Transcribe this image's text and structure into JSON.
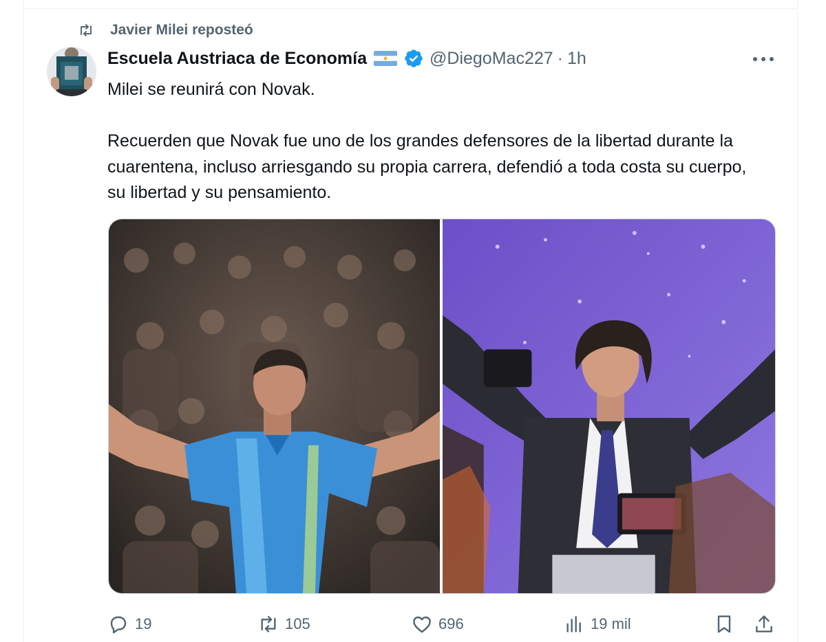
{
  "repost": {
    "icon": "retweet-icon",
    "text": "Javier Milei reposteó"
  },
  "author": {
    "display_name": "Escuela Austriaca de Economía",
    "flag": "argentina-flag-icon",
    "verified_icon": "verified-badge-icon",
    "handle": "@DiegoMac227",
    "separator": "·",
    "time": "1h"
  },
  "tweet": {
    "paragraphs": [
      "Milei se reunirá con Novak.",
      "Recuerden que Novak fue uno de los grandes defensores de la libertad durante la cuarentena, incluso arriesgando su propia carrera, defendió a toda costa su cuerpo, su libertad y su pensamiento."
    ]
  },
  "media": [
    {
      "kind": "photo",
      "subject": "tennis player celebrating with arms raised"
    },
    {
      "kind": "photo",
      "subject": "man in suit celebrating on stage with arms raised"
    }
  ],
  "actions": {
    "reply": {
      "icon": "reply-icon",
      "count": "19"
    },
    "repost": {
      "icon": "retweet-icon",
      "count": "105"
    },
    "like": {
      "icon": "heart-icon",
      "count": "696"
    },
    "views": {
      "icon": "views-icon",
      "count": "19 mil"
    },
    "bookmark": {
      "icon": "bookmark-icon"
    },
    "share": {
      "icon": "share-icon"
    }
  },
  "colors": {
    "text_primary": "#0f1419",
    "text_secondary": "#536471",
    "verified_blue": "#1d9bf0",
    "border": "#eff3f4"
  }
}
